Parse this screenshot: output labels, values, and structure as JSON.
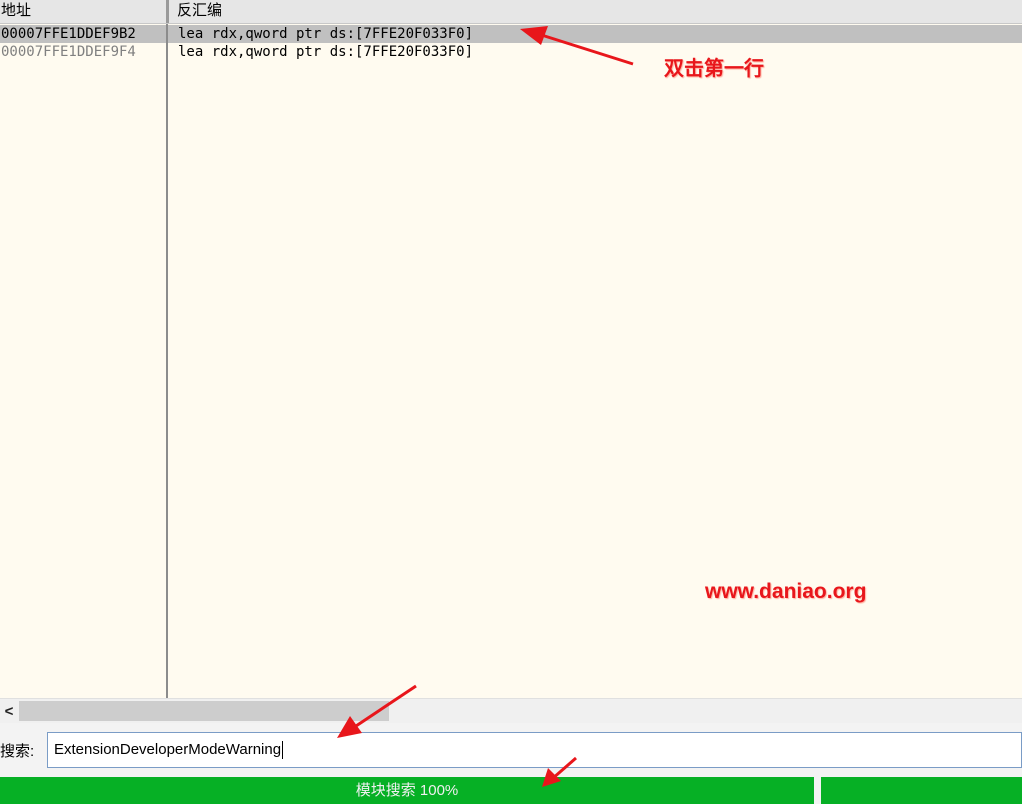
{
  "header": {
    "address_column": "地址",
    "disassembly_column": "反汇编"
  },
  "rows": [
    {
      "address": "00007FFE1DDEF9B2",
      "disassembly": "lea rdx,qword ptr ds:[7FFE20F033F0]",
      "selected": true
    },
    {
      "address": "00007FFE1DDEF9F4",
      "disassembly": "lea rdx,qword ptr ds:[7FFE20F033F0]",
      "selected": false
    }
  ],
  "scrollbar": {
    "left_arrow": "<"
  },
  "search": {
    "label": "搜索:",
    "value": "ExtensionDeveloperModeWarning"
  },
  "status": {
    "progress_text": "模块搜索 100%",
    "progress_fraction": 1.0,
    "color": "#06b025"
  },
  "annotations": {
    "instruction": "双击第一行",
    "watermark": "www.daniao.org",
    "color": "#e8161b"
  }
}
